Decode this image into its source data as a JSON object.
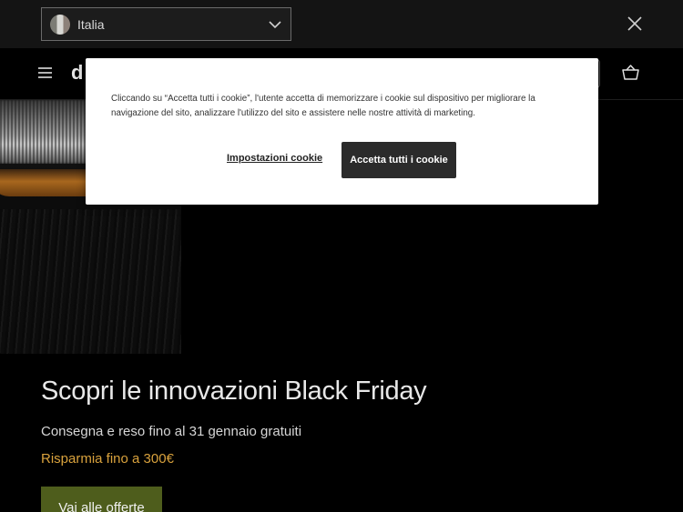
{
  "country_bar": {
    "selected_country": "Italia",
    "flag_icon": "italy-flag-icon",
    "dropdown_icon": "chevron-down-icon",
    "close_icon": "close-icon"
  },
  "header": {
    "menu_icon": "hamburger-menu-icon",
    "logo_fragment": "d",
    "basket_icon": "shopping-basket-icon"
  },
  "hero": {
    "title": "Scopri le innovazioni Black Friday",
    "subtitle": "Consegna e reso fino al 31 gennaio gratuiti",
    "promo": "Risparmia fino a 300€",
    "cta_label": "Vai alle offerte",
    "promo_color": "#d9a23d",
    "cta_color": "#4e5d1c"
  },
  "cookie_banner": {
    "text": "Cliccando su “Accetta tutti i cookie”, l'utente accetta di memorizzare i cookie sul dispositivo per migliorare la navigazione del sito, analizzare l'utilizzo del sito e assistere nelle nostre attività di marketing.",
    "settings_label": "Impostazioni cookie",
    "accept_label": "Accetta tutti i cookie"
  }
}
